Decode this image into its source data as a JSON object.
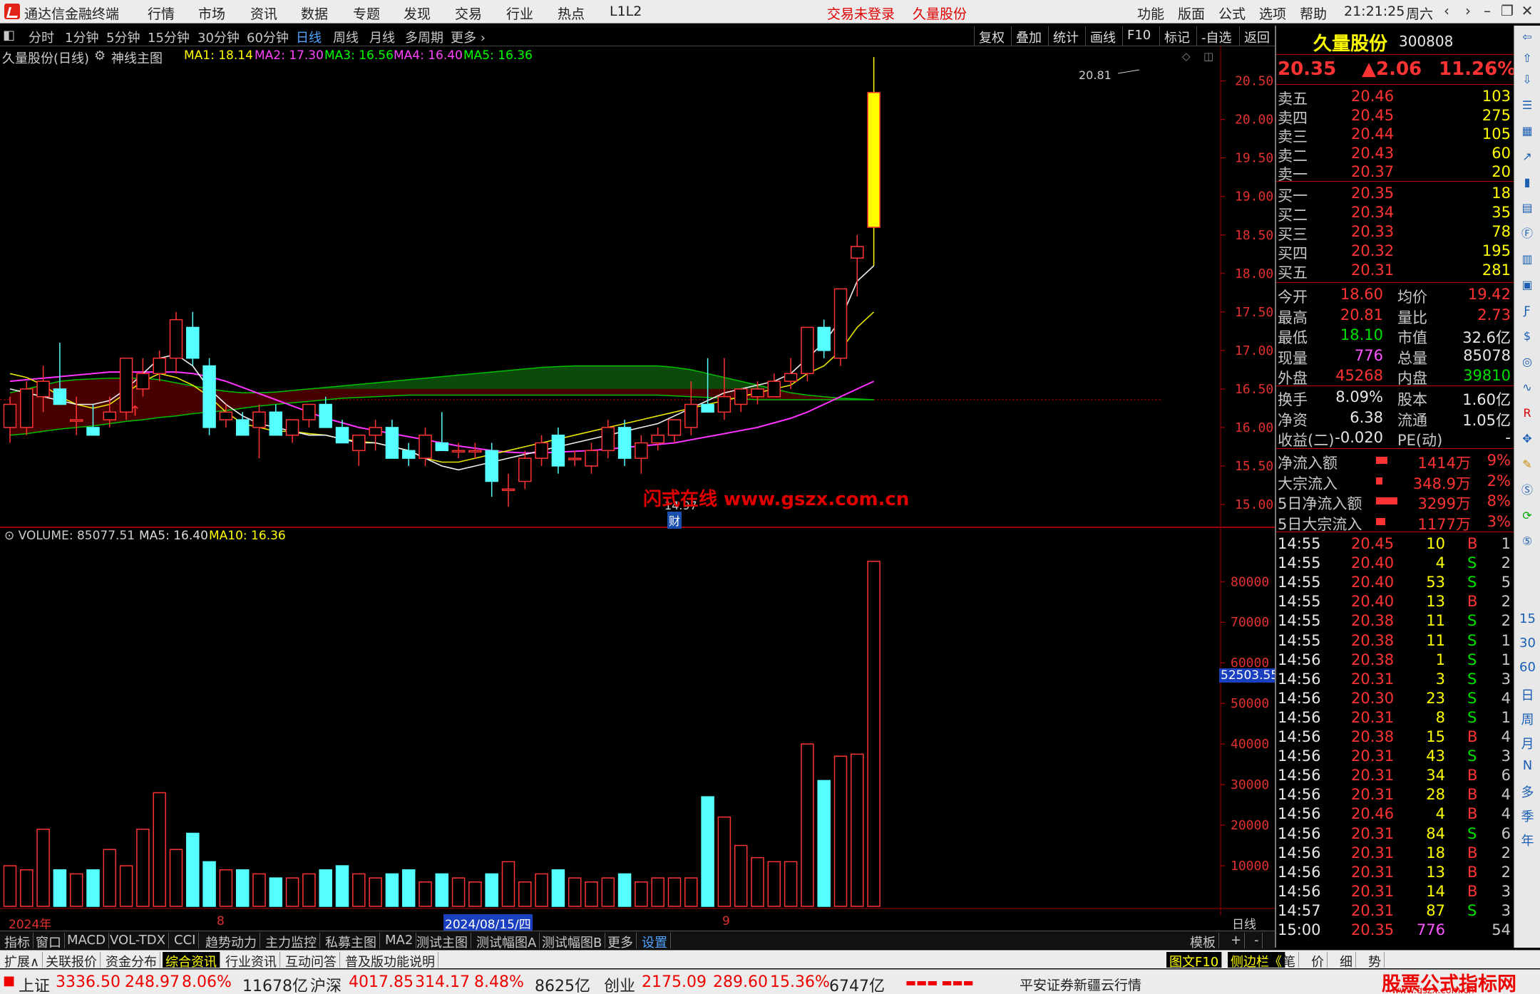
{
  "menubar": {
    "app_title": "通达信金融终端",
    "items": [
      "行情",
      "市场",
      "资讯",
      "数据",
      "专题",
      "发现",
      "交易",
      "行业",
      "热点",
      "L1L2"
    ],
    "login_status": "交易未登录",
    "stock_name": "久量股份",
    "right_items": [
      "功能",
      "版面",
      "公式",
      "选项",
      "帮助"
    ],
    "clock": "21:21:25",
    "weekday": "周六"
  },
  "periodbar": {
    "items": [
      "分时",
      "1分钟",
      "5分钟",
      "15分钟",
      "30分钟",
      "60分钟",
      "日线",
      "周线",
      "月线",
      "多周期",
      "更多"
    ],
    "active": "日线",
    "right_buttons": [
      "复权",
      "叠加",
      "统计",
      "画线",
      "F10",
      "标记",
      "-自选",
      "返回"
    ]
  },
  "chart_header": {
    "name": "久量股份(日线)",
    "indicator": "神线主图",
    "ma": [
      {
        "label": "MA1: 18.14",
        "color": "#ffff00"
      },
      {
        "label": "MA2: 17.30",
        "color": "#ff00ff"
      },
      {
        "label": "MA3: 16.56",
        "color": "#00ff00"
      },
      {
        "label": "MA4: 16.40",
        "color": "#ff00ff"
      },
      {
        "label": "MA5: 16.36",
        "color": "#00ff00"
      }
    ]
  },
  "annotations": {
    "high_label": "20.81",
    "low_label": "14.97",
    "cai_badge": "财",
    "watermark": "闪式在线 www.gszx.com.cn"
  },
  "volume_header": {
    "label": "VOLUME: 85077.51",
    "ma5": "MA5: 16.40",
    "ma10": "MA10: 16.36"
  },
  "price_axis": [
    "20.50",
    "20.00",
    "19.50",
    "19.00",
    "18.50",
    "18.00",
    "17.50",
    "17.00",
    "16.50",
    "16.00",
    "15.50",
    "15.00"
  ],
  "volume_axis": [
    "80000",
    "70000",
    "60000",
    "50000",
    "40000",
    "30000",
    "20000",
    "10000"
  ],
  "volume_marker": "52503.55",
  "time_axis": {
    "year": "2024年",
    "m8": "8",
    "cursor_date": "2024/08/15/四",
    "m9": "9",
    "period": "日线"
  },
  "chart_data": {
    "type": "candlestick",
    "candles": [
      {
        "o": 16.0,
        "h": 16.4,
        "l": 15.8,
        "c": 16.3
      },
      {
        "o": 16.0,
        "h": 16.6,
        "l": 15.9,
        "c": 16.5
      },
      {
        "o": 16.4,
        "h": 16.8,
        "l": 16.2,
        "c": 16.6
      },
      {
        "o": 16.5,
        "h": 17.1,
        "l": 16.3,
        "c": 16.3
      },
      {
        "o": 16.1,
        "h": 16.4,
        "l": 15.9,
        "c": 16.1
      },
      {
        "o": 16.0,
        "h": 16.3,
        "l": 15.9,
        "c": 15.9
      },
      {
        "o": 16.1,
        "h": 16.4,
        "l": 16.0,
        "c": 16.2
      },
      {
        "o": 16.2,
        "h": 16.9,
        "l": 16.1,
        "c": 16.9
      },
      {
        "o": 16.5,
        "h": 16.9,
        "l": 16.4,
        "c": 16.7
      },
      {
        "o": 16.7,
        "h": 17.0,
        "l": 16.6,
        "c": 16.9
      },
      {
        "o": 16.9,
        "h": 17.5,
        "l": 16.7,
        "c": 17.4
      },
      {
        "o": 17.3,
        "h": 17.5,
        "l": 16.8,
        "c": 16.9
      },
      {
        "o": 16.8,
        "h": 16.9,
        "l": 15.9,
        "c": 16.0
      },
      {
        "o": 16.1,
        "h": 16.3,
        "l": 16.0,
        "c": 16.2
      },
      {
        "o": 16.1,
        "h": 16.2,
        "l": 15.9,
        "c": 15.9
      },
      {
        "o": 16.0,
        "h": 16.3,
        "l": 15.6,
        "c": 16.2
      },
      {
        "o": 16.2,
        "h": 16.3,
        "l": 15.9,
        "c": 15.9
      },
      {
        "o": 15.9,
        "h": 16.1,
        "l": 15.8,
        "c": 16.1
      },
      {
        "o": 16.1,
        "h": 16.3,
        "l": 16.0,
        "c": 16.3
      },
      {
        "o": 16.3,
        "h": 16.4,
        "l": 16.0,
        "c": 16.0
      },
      {
        "o": 16.0,
        "h": 16.1,
        "l": 15.8,
        "c": 15.8
      },
      {
        "o": 15.7,
        "h": 15.9,
        "l": 15.5,
        "c": 15.9
      },
      {
        "o": 15.9,
        "h": 16.1,
        "l": 15.7,
        "c": 16.0
      },
      {
        "o": 16.0,
        "h": 16.1,
        "l": 15.6,
        "c": 15.6
      },
      {
        "o": 15.7,
        "h": 15.8,
        "l": 15.5,
        "c": 15.6
      },
      {
        "o": 15.6,
        "h": 16.0,
        "l": 15.5,
        "c": 15.9
      },
      {
        "o": 15.8,
        "h": 16.2,
        "l": 15.7,
        "c": 15.7
      },
      {
        "o": 15.7,
        "h": 15.8,
        "l": 15.6,
        "c": 15.7
      },
      {
        "o": 15.7,
        "h": 15.8,
        "l": 15.6,
        "c": 15.7
      },
      {
        "o": 15.7,
        "h": 15.8,
        "l": 15.1,
        "c": 15.3
      },
      {
        "o": 15.2,
        "h": 15.4,
        "l": 14.97,
        "c": 15.2
      },
      {
        "o": 15.3,
        "h": 15.7,
        "l": 15.2,
        "c": 15.6
      },
      {
        "o": 15.6,
        "h": 15.9,
        "l": 15.5,
        "c": 15.8
      },
      {
        "o": 15.9,
        "h": 16.0,
        "l": 15.4,
        "c": 15.5
      },
      {
        "o": 15.6,
        "h": 15.7,
        "l": 15.5,
        "c": 15.6
      },
      {
        "o": 15.5,
        "h": 15.8,
        "l": 15.4,
        "c": 15.7
      },
      {
        "o": 15.7,
        "h": 16.1,
        "l": 15.6,
        "c": 16.0
      },
      {
        "o": 16.0,
        "h": 16.1,
        "l": 15.5,
        "c": 15.6
      },
      {
        "o": 15.6,
        "h": 15.9,
        "l": 15.4,
        "c": 15.8
      },
      {
        "o": 15.8,
        "h": 16.0,
        "l": 15.7,
        "c": 15.9
      },
      {
        "o": 15.9,
        "h": 16.1,
        "l": 15.8,
        "c": 16.1
      },
      {
        "o": 16.0,
        "h": 16.6,
        "l": 15.9,
        "c": 16.3
      },
      {
        "o": 16.3,
        "h": 16.9,
        "l": 16.2,
        "c": 16.2
      },
      {
        "o": 16.2,
        "h": 16.9,
        "l": 16.1,
        "c": 16.4
      },
      {
        "o": 16.3,
        "h": 16.5,
        "l": 16.2,
        "c": 16.5
      },
      {
        "o": 16.4,
        "h": 16.6,
        "l": 16.3,
        "c": 16.5
      },
      {
        "o": 16.4,
        "h": 16.7,
        "l": 16.4,
        "c": 16.6
      },
      {
        "o": 16.6,
        "h": 16.9,
        "l": 16.5,
        "c": 16.7
      },
      {
        "o": 16.7,
        "h": 17.3,
        "l": 16.6,
        "c": 17.3
      },
      {
        "o": 17.3,
        "h": 17.4,
        "l": 16.9,
        "c": 17.0
      },
      {
        "o": 16.9,
        "h": 17.8,
        "l": 16.8,
        "c": 17.8
      },
      {
        "o": 18.2,
        "h": 18.5,
        "l": 17.7,
        "c": 18.35
      },
      {
        "o": 18.6,
        "h": 20.81,
        "l": 18.1,
        "c": 20.35
      }
    ],
    "volumes": [
      10,
      9,
      19,
      9,
      8,
      9,
      14,
      10,
      19,
      28,
      14,
      18,
      11,
      9,
      9,
      8,
      7,
      7,
      8,
      9,
      10,
      8,
      7,
      8,
      9,
      6,
      8,
      7,
      6,
      8,
      11,
      6,
      8,
      9,
      7,
      6,
      7,
      8,
      6,
      7,
      7,
      7,
      27,
      22,
      15,
      12,
      11,
      11,
      40,
      31,
      37,
      37.5,
      85
    ],
    "ma_yellow": [
      16.7,
      16.65,
      16.55,
      16.4,
      16.3,
      16.25,
      16.3,
      16.45,
      16.6,
      16.7,
      16.65,
      16.55,
      16.4,
      16.2,
      16.05,
      16.0,
      15.95,
      15.95,
      15.92,
      15.9,
      15.85,
      15.82,
      15.8,
      15.75,
      15.7,
      15.6,
      15.55,
      15.55,
      15.6,
      15.65,
      15.7,
      15.75,
      15.8,
      15.85,
      15.9,
      15.95,
      16.0,
      16.05,
      16.1,
      16.15,
      16.2,
      16.25,
      16.3,
      16.35,
      16.4,
      16.45,
      16.5,
      16.55,
      16.7,
      16.8,
      17.0,
      17.3,
      17.5
    ],
    "ma_white": [
      16.5,
      16.45,
      16.4,
      16.35,
      16.3,
      16.3,
      16.35,
      16.5,
      16.7,
      16.9,
      16.95,
      16.8,
      16.5,
      16.3,
      16.15,
      16.05,
      16.0,
      15.95,
      15.9,
      15.9,
      15.85,
      15.8,
      15.8,
      15.75,
      15.7,
      15.6,
      15.5,
      15.45,
      15.5,
      15.55,
      15.6,
      15.65,
      15.7,
      15.75,
      15.8,
      15.85,
      15.9,
      15.95,
      16.0,
      16.05,
      16.15,
      16.25,
      16.35,
      16.45,
      16.5,
      16.55,
      16.6,
      16.7,
      16.9,
      17.1,
      17.4,
      17.9,
      18.1
    ],
    "ma_magenta": [
      16.6,
      16.62,
      16.64,
      16.66,
      16.68,
      16.7,
      16.72,
      16.72,
      16.72,
      16.72,
      16.72,
      16.7,
      16.66,
      16.6,
      16.52,
      16.44,
      16.36,
      16.28,
      16.2,
      16.12,
      16.06,
      16.0,
      15.96,
      15.92,
      15.88,
      15.84,
      15.8,
      15.76,
      15.73,
      15.7,
      15.68,
      15.67,
      15.67,
      15.68,
      15.69,
      15.7,
      15.72,
      15.74,
      15.76,
      15.78,
      15.8,
      15.84,
      15.88,
      15.92,
      15.96,
      16.0,
      16.06,
      16.12,
      16.2,
      16.3,
      16.4,
      16.5,
      16.6
    ],
    "band_upper": [
      16.45,
      16.5,
      16.55,
      16.6,
      16.62,
      16.63,
      16.64,
      16.64,
      16.64,
      16.62,
      16.58,
      16.54,
      16.5,
      16.47,
      16.45,
      16.45,
      16.46,
      16.48,
      16.5,
      16.52,
      16.54,
      16.56,
      16.58,
      16.6,
      16.62,
      16.64,
      16.66,
      16.68,
      16.7,
      16.72,
      16.74,
      16.76,
      16.78,
      16.79,
      16.8,
      16.8,
      16.8,
      16.8,
      16.8,
      16.8,
      16.78,
      16.75,
      16.7,
      16.65,
      16.6,
      16.55,
      16.5,
      16.45,
      16.42,
      16.4,
      16.38,
      16.37,
      16.36
    ],
    "band_lower": [
      15.9,
      15.92,
      15.95,
      15.98,
      16.0,
      16.02,
      16.05,
      16.08,
      16.1,
      16.13,
      16.15,
      16.18,
      16.2,
      16.22,
      16.25,
      16.28,
      16.3,
      16.32,
      16.34,
      16.36,
      16.38,
      16.39,
      16.4,
      16.41,
      16.42,
      16.42,
      16.42,
      16.42,
      16.42,
      16.42,
      16.42,
      16.42,
      16.42,
      16.42,
      16.42,
      16.42,
      16.42,
      16.42,
      16.42,
      16.42,
      16.41,
      16.4,
      16.39,
      16.38,
      16.37,
      16.36,
      16.36,
      16.36,
      16.36,
      16.36,
      16.36,
      16.36,
      16.36
    ]
  },
  "quote": {
    "name": "久量股份",
    "code": "300808",
    "price": "20.35",
    "change": "▲2.06",
    "pct": "11.26%",
    "asks": [
      {
        "label": "卖五",
        "price": "20.46",
        "vol": "103"
      },
      {
        "label": "卖四",
        "price": "20.45",
        "vol": "275"
      },
      {
        "label": "卖三",
        "price": "20.44",
        "vol": "105"
      },
      {
        "label": "卖二",
        "price": "20.43",
        "vol": "60"
      },
      {
        "label": "卖一",
        "price": "20.37",
        "vol": "20"
      }
    ],
    "bids": [
      {
        "label": "买一",
        "price": "20.35",
        "vol": "18"
      },
      {
        "label": "买二",
        "price": "20.34",
        "vol": "35"
      },
      {
        "label": "买三",
        "price": "20.33",
        "vol": "78"
      },
      {
        "label": "买四",
        "price": "20.32",
        "vol": "195"
      },
      {
        "label": "买五",
        "price": "20.31",
        "vol": "281"
      }
    ],
    "stats1": [
      {
        "l1": "今开",
        "v1": "18.60",
        "c1": "red",
        "l2": "均价",
        "v2": "19.42",
        "c2": "red"
      },
      {
        "l1": "最高",
        "v1": "20.81",
        "c1": "red",
        "l2": "量比",
        "v2": "2.73",
        "c2": "red"
      },
      {
        "l1": "最低",
        "v1": "18.10",
        "c1": "green",
        "l2": "市值",
        "v2": "32.6亿",
        "c2": "white"
      },
      {
        "l1": "现量",
        "v1": "776",
        "c1": "magenta",
        "l2": "总量",
        "v2": "85078",
        "c2": "white"
      },
      {
        "l1": "外盘",
        "v1": "45268",
        "c1": "red",
        "l2": "内盘",
        "v2": "39810",
        "c2": "green"
      }
    ],
    "stats2": [
      {
        "l1": "换手",
        "v1": "8.09%",
        "c1": "white",
        "l2": "股本",
        "v2": "1.60亿",
        "c2": "white"
      },
      {
        "l1": "净资",
        "v1": "6.38",
        "c1": "white",
        "l2": "流通",
        "v2": "1.05亿",
        "c2": "white"
      },
      {
        "l1": "收益(二)",
        "v1": "-0.020",
        "c1": "white",
        "l2": "PE(动)",
        "v2": "-",
        "c2": "white"
      }
    ],
    "flows": [
      {
        "label": "净流入额",
        "value": "1414万",
        "pct": "9%",
        "bar": 0.3
      },
      {
        "label": "大宗流入",
        "value": "348.9万",
        "pct": "2%",
        "bar": 0.08
      },
      {
        "label": "5日净流入额",
        "value": "3299万",
        "pct": "8%",
        "bar": 0.7
      },
      {
        "label": "5日大宗流入",
        "value": "1177万",
        "pct": "3%",
        "bar": 0.2
      }
    ],
    "ticks": [
      {
        "t": "14:55",
        "p": "20.45",
        "v": "10",
        "s": "B",
        "n": "1"
      },
      {
        "t": "14:55",
        "p": "20.40",
        "v": "4",
        "s": "S",
        "n": "2"
      },
      {
        "t": "14:55",
        "p": "20.40",
        "v": "53",
        "s": "S",
        "n": "5"
      },
      {
        "t": "14:55",
        "p": "20.40",
        "v": "13",
        "s": "B",
        "n": "2"
      },
      {
        "t": "14:55",
        "p": "20.38",
        "v": "11",
        "s": "S",
        "n": "2"
      },
      {
        "t": "14:55",
        "p": "20.38",
        "v": "11",
        "s": "S",
        "n": "1"
      },
      {
        "t": "14:56",
        "p": "20.38",
        "v": "1",
        "s": "S",
        "n": "1"
      },
      {
        "t": "14:56",
        "p": "20.31",
        "v": "3",
        "s": "S",
        "n": "3"
      },
      {
        "t": "14:56",
        "p": "20.30",
        "v": "23",
        "s": "S",
        "n": "4"
      },
      {
        "t": "14:56",
        "p": "20.31",
        "v": "8",
        "s": "S",
        "n": "1"
      },
      {
        "t": "14:56",
        "p": "20.38",
        "v": "15",
        "s": "B",
        "n": "4"
      },
      {
        "t": "14:56",
        "p": "20.31",
        "v": "43",
        "s": "S",
        "n": "3"
      },
      {
        "t": "14:56",
        "p": "20.31",
        "v": "34",
        "s": "B",
        "n": "6"
      },
      {
        "t": "14:56",
        "p": "20.31",
        "v": "28",
        "s": "B",
        "n": "4"
      },
      {
        "t": "14:56",
        "p": "20.46",
        "v": "4",
        "s": "B",
        "n": "4"
      },
      {
        "t": "14:56",
        "p": "20.31",
        "v": "84",
        "s": "S",
        "n": "6"
      },
      {
        "t": "14:56",
        "p": "20.31",
        "v": "18",
        "s": "B",
        "n": "2"
      },
      {
        "t": "14:56",
        "p": "20.31",
        "v": "13",
        "s": "B",
        "n": "2"
      },
      {
        "t": "14:56",
        "p": "20.31",
        "v": "14",
        "s": "B",
        "n": "3"
      },
      {
        "t": "14:57",
        "p": "20.31",
        "v": "87",
        "s": "S",
        "n": "3"
      },
      {
        "t": "15:00",
        "p": "20.35",
        "v": "776",
        "s": "",
        "n": "54"
      }
    ]
  },
  "sidebar_text": [
    "15",
    "30",
    "60",
    "日",
    "周",
    "月",
    "N",
    "多",
    "季",
    "年"
  ],
  "tabs1": [
    "指标",
    "窗口",
    "MACD",
    "VOL-TDX",
    "CCI",
    "趋势动力",
    "主力监控",
    "私募主图",
    "MA2",
    "测试主图",
    "测试幅图A",
    "测试幅图B",
    "更多",
    "设置"
  ],
  "tabs1_right": [
    "模板",
    "+",
    "-"
  ],
  "tabs2": [
    "扩展∧",
    "关联报价",
    "资金分布",
    "综合资讯",
    "行业资讯",
    "互动问答",
    "普及版功能说明"
  ],
  "tabs2_right": [
    "图文F10",
    "侧边栏《",
    "笔",
    "价",
    "细",
    "势"
  ],
  "statusbar": {
    "sh_label": "上证",
    "sh_val": "3336.50",
    "sh_chg": "248.97",
    "sh_pct": "8.06%",
    "sh_amt": "11678亿",
    "sz_label": "沪深",
    "sz_val": "4017.85",
    "sz_chg": "314.17",
    "sz_pct": "8.48%",
    "sz_amt": "8625亿",
    "cy_label": "创业",
    "cy_val": "2175.09",
    "cy_chg": "289.60",
    "cy_pct": "15.36%",
    "cy_amt": "6747亿",
    "broker": "平安证券新疆云行情",
    "brand": "股票公式指标网",
    "brand_url": "www.gszx.com.cn"
  },
  "colors": {
    "up": "#ff3333",
    "down": "#54ffff",
    "grid": "#8b0000",
    "accent": "#4fa3ff"
  }
}
